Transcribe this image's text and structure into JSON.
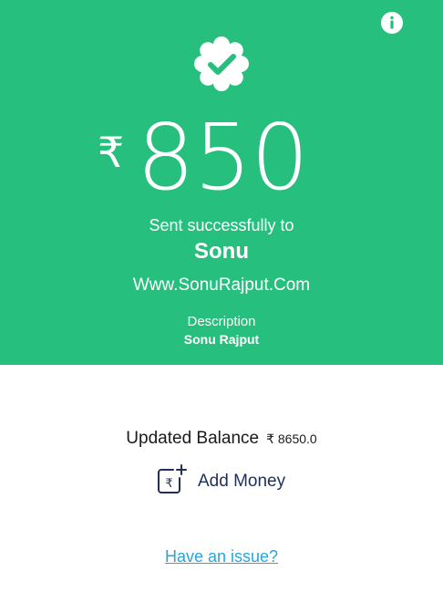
{
  "header": {
    "info_icon": "info-icon",
    "badge_icon": "verified-check-badge-icon"
  },
  "transaction": {
    "currency_symbol": "₹",
    "amount": "850",
    "status_text": "Sent successfully to",
    "recipient_name": "Sonu",
    "recipient_url": "Www.SonuRajput.Com",
    "description_label": "Description",
    "description_value": "Sonu Rajput"
  },
  "balance": {
    "label": "Updated Balance",
    "value": "₹ 8650.0"
  },
  "actions": {
    "add_money_label": "Add Money",
    "add_money_icon": "wallet-add-rupee-icon",
    "issue_link": "Have an issue?"
  },
  "colors": {
    "success_green": "#26bf7d",
    "link_blue": "#24a6dc",
    "navy": "#1f2f5a"
  }
}
